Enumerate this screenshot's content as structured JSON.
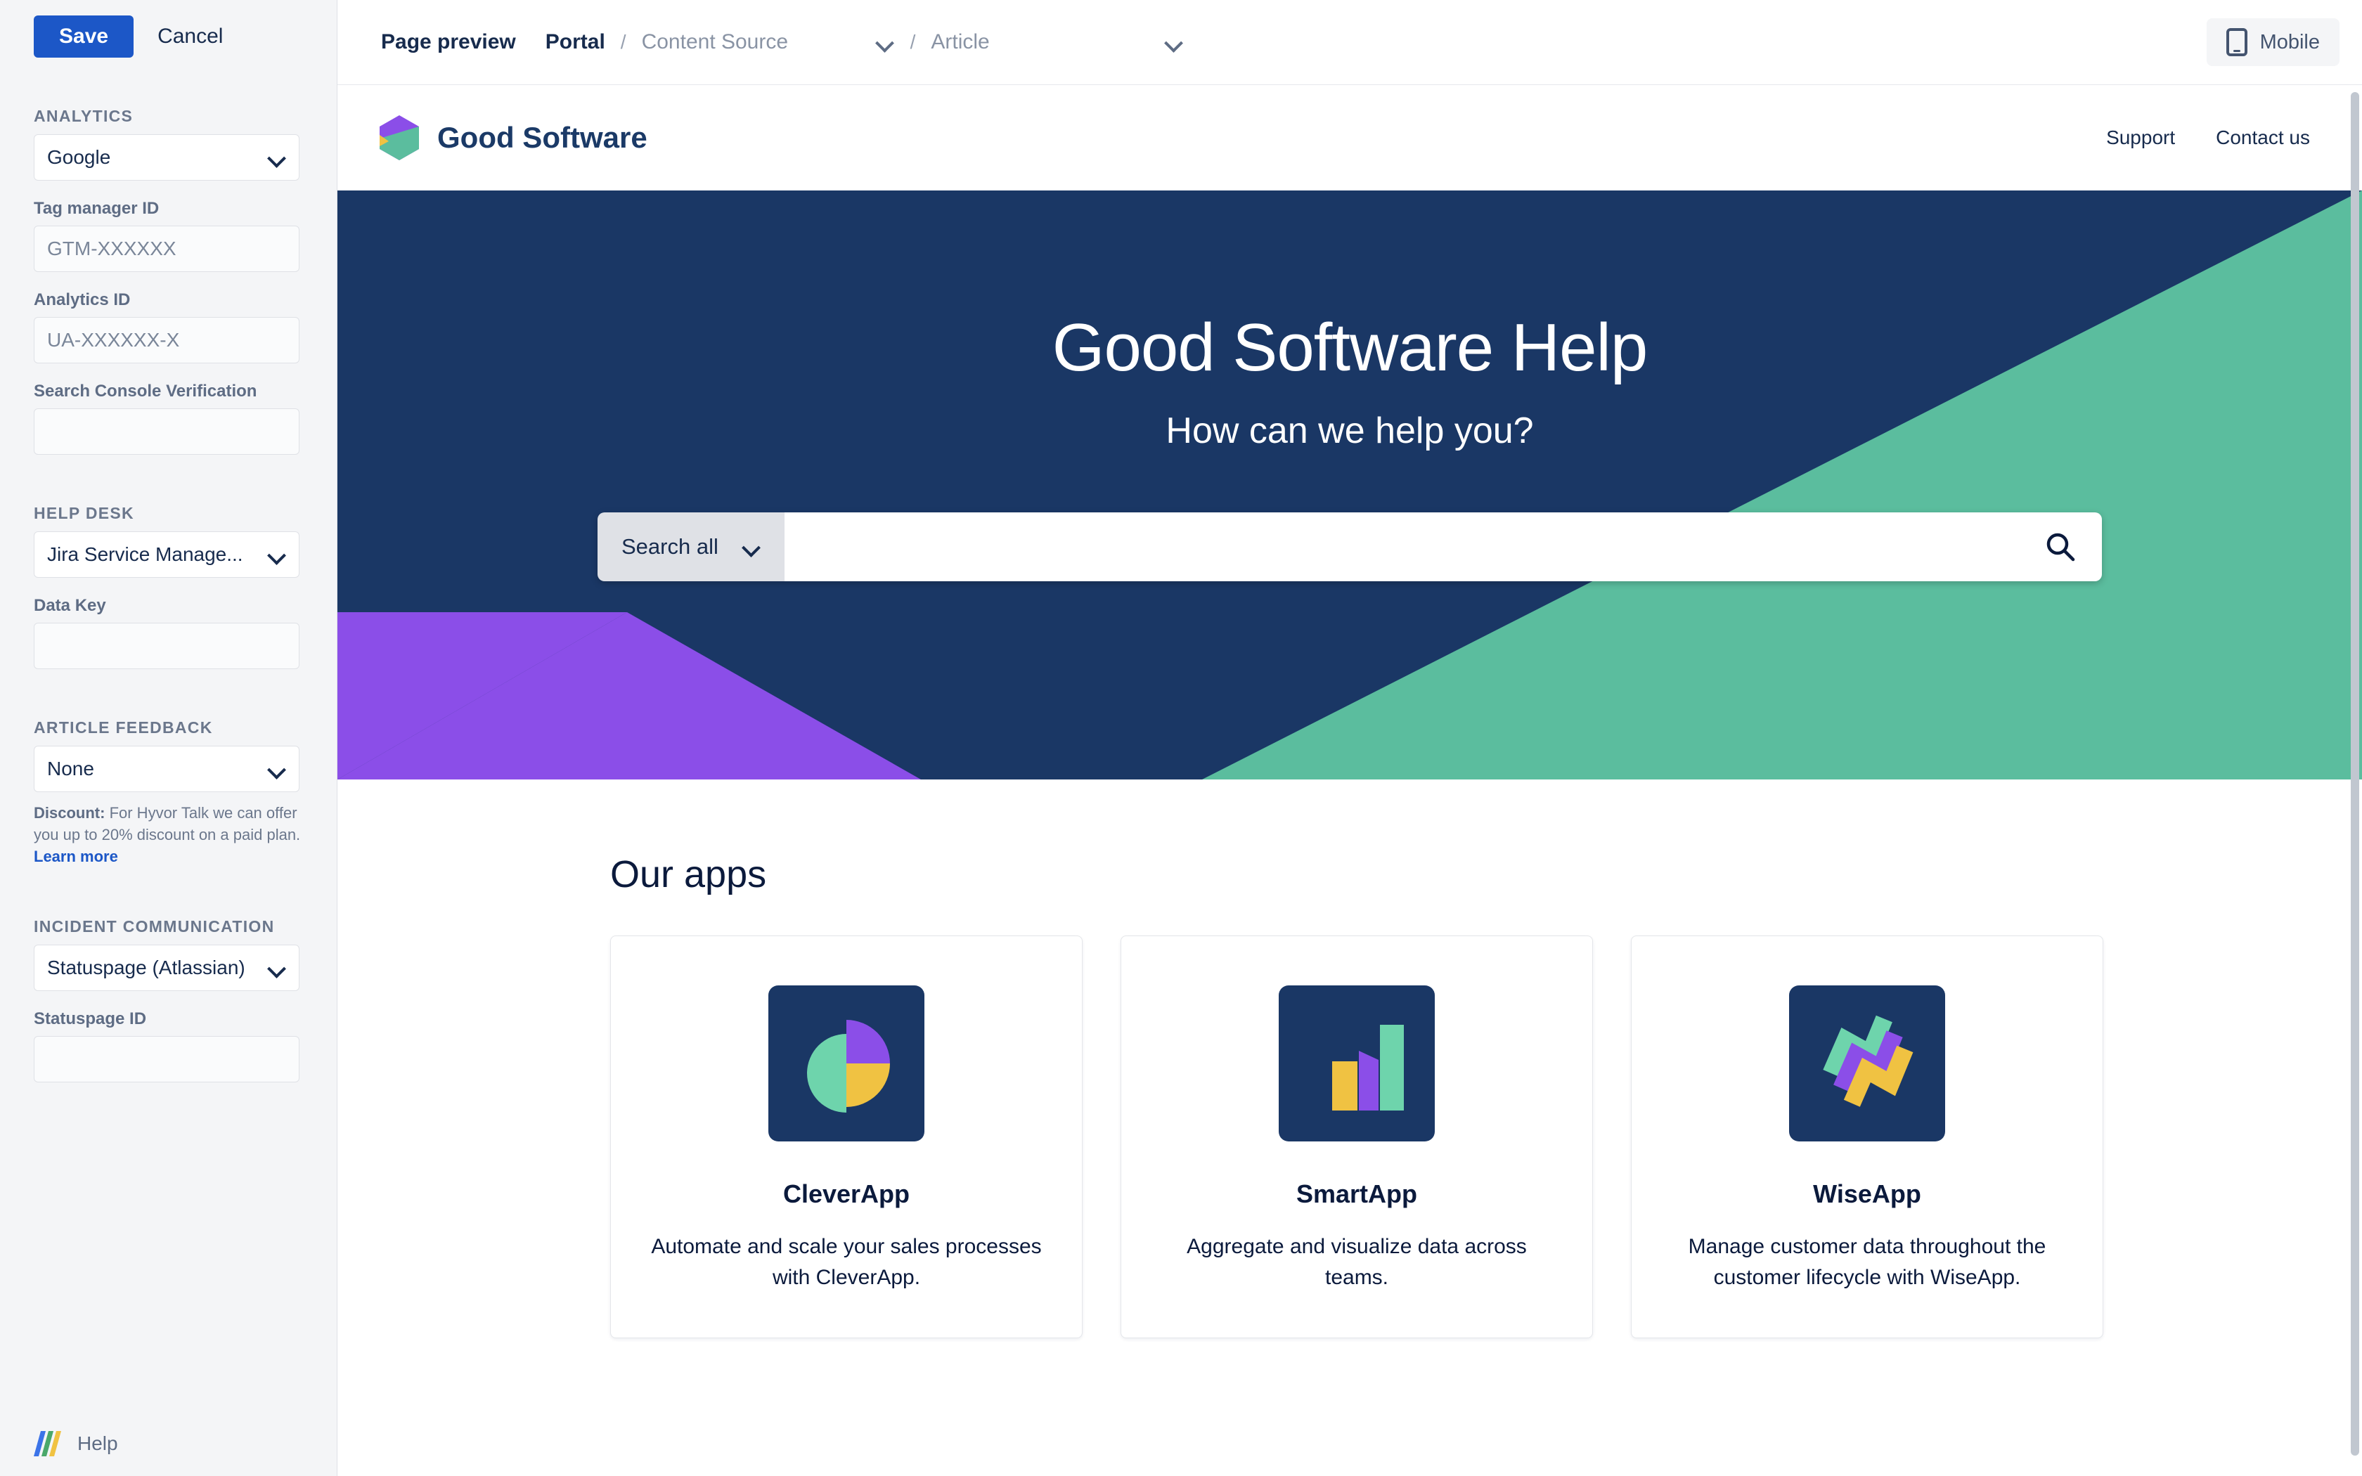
{
  "sidebar": {
    "save_label": "Save",
    "cancel_label": "Cancel",
    "sections": {
      "analytics": {
        "title": "ANALYTICS",
        "provider_value": "Google",
        "tag_manager_label": "Tag manager ID",
        "tag_manager_placeholder": "GTM-XXXXXX",
        "tag_manager_value": "",
        "analytics_id_label": "Analytics ID",
        "analytics_id_placeholder": "UA-XXXXXX-X",
        "analytics_id_value": "",
        "search_console_label": "Search Console Verification",
        "search_console_placeholder": "",
        "search_console_value": ""
      },
      "help_desk": {
        "title": "HELP DESK",
        "provider_value": "Jira Service Manage...",
        "data_key_label": "Data Key",
        "data_key_placeholder": "",
        "data_key_value": ""
      },
      "article_feedback": {
        "title": "ARTICLE FEEDBACK",
        "provider_value": "None",
        "hint_bold": "Discount:",
        "hint_text": " For Hyvor Talk we can offer you up to 20% discount on a paid plan. ",
        "hint_link": "Learn more"
      },
      "incident_communication": {
        "title": "INCIDENT COMMUNICATION",
        "provider_value": "Statuspage (Atlassian)",
        "statuspage_id_label": "Statuspage ID",
        "statuspage_id_placeholder": "",
        "statuspage_id_value": ""
      }
    },
    "help_label": "Help"
  },
  "toolbar": {
    "title": "Page preview",
    "breadcrumb_root": "Portal",
    "separator": "/",
    "content_source_placeholder": "Content Source",
    "article_placeholder": "Article",
    "device_label": "Mobile"
  },
  "portal": {
    "brand_name": "Good Software",
    "nav": [
      {
        "label": "Support"
      },
      {
        "label": "Contact us"
      }
    ],
    "hero": {
      "title": "Good Software Help",
      "subtitle": "How can we help you?",
      "search_scope": "Search all",
      "search_value": "",
      "search_placeholder": ""
    },
    "apps": {
      "heading": "Our apps",
      "cards": [
        {
          "icon": "pie-chart-icon",
          "title": "CleverApp",
          "description": "Automate and scale your sales processes with CleverApp."
        },
        {
          "icon": "bar-chart-icon",
          "title": "SmartApp",
          "description": "Aggregate and visualize data across teams."
        },
        {
          "icon": "zigzag-lines-icon",
          "title": "WiseApp",
          "description": "Manage customer data throughout the customer lifecycle with WiseApp."
        }
      ]
    }
  },
  "colors": {
    "primary_blue": "#1c57c7",
    "hero_navy": "#1a3765",
    "brand_green": "#5bbd9e",
    "brand_purple": "#8b4ee8",
    "brand_yellow": "#f0c242",
    "sidebar_bg": "#f4f5f7"
  }
}
